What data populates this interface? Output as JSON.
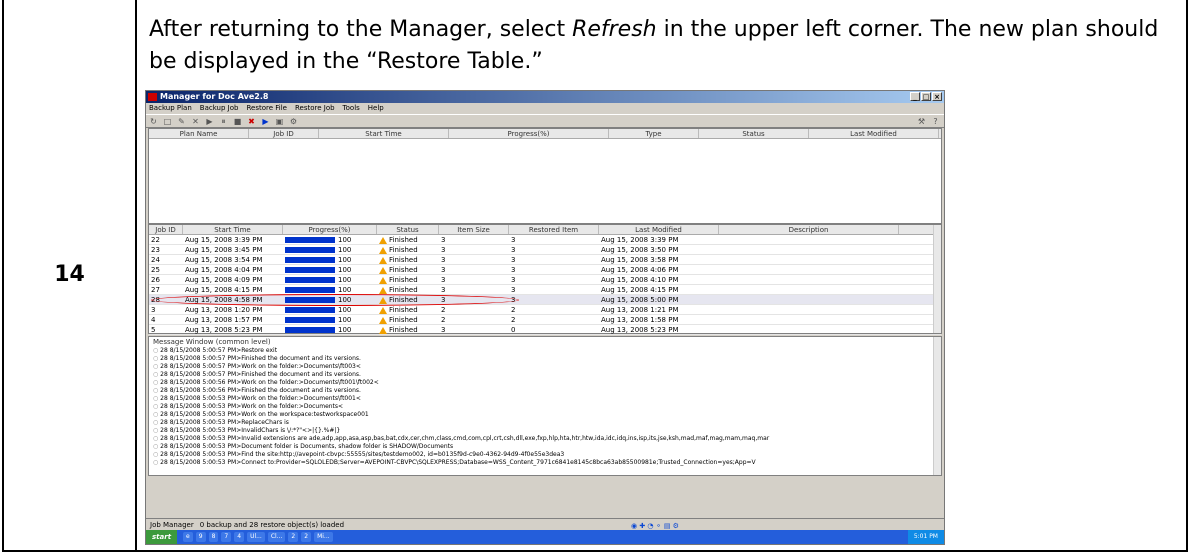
{
  "step_number": "14",
  "instruction": {
    "before": "After returning to the Manager, select ",
    "emphasis": "Refresh",
    "after": " in the upper left corner. The new plan should be displayed in the “Restore Table.”"
  },
  "app": {
    "title": "Manager for Doc Ave2.8",
    "menu": [
      "Backup Plan",
      "Backup Job",
      "Restore File",
      "Restore Job",
      "Tools",
      "Help"
    ],
    "plan_columns": [
      "Plan Name",
      "Job ID",
      "Start Time",
      "Progress(%)",
      "Type",
      "Status",
      "Last Modified"
    ],
    "job_columns": [
      "Job ID",
      "Start Time",
      "Progress(%)",
      "Status",
      "Item Size",
      "Restored Item",
      "Last Modified",
      "Description"
    ],
    "jobs": [
      {
        "id": "22",
        "start": "Aug 15, 2008 3:39 PM",
        "progress": "100",
        "status": "Finished",
        "size": "3",
        "restored": "3",
        "modified": "Aug 15, 2008 3:39 PM"
      },
      {
        "id": "23",
        "start": "Aug 15, 2008 3:45 PM",
        "progress": "100",
        "status": "Finished",
        "size": "3",
        "restored": "3",
        "modified": "Aug 15, 2008 3:50 PM"
      },
      {
        "id": "24",
        "start": "Aug 15, 2008 3:54 PM",
        "progress": "100",
        "status": "Finished",
        "size": "3",
        "restored": "3",
        "modified": "Aug 15, 2008 3:58 PM"
      },
      {
        "id": "25",
        "start": "Aug 15, 2008 4:04 PM",
        "progress": "100",
        "status": "Finished",
        "size": "3",
        "restored": "3",
        "modified": "Aug 15, 2008 4:06 PM"
      },
      {
        "id": "26",
        "start": "Aug 15, 2008 4:09 PM",
        "progress": "100",
        "status": "Finished",
        "size": "3",
        "restored": "3",
        "modified": "Aug 15, 2008 4:10 PM"
      },
      {
        "id": "27",
        "start": "Aug 15, 2008 4:15 PM",
        "progress": "100",
        "status": "Finished",
        "size": "3",
        "restored": "3",
        "modified": "Aug 15, 2008 4:15 PM"
      },
      {
        "id": "28",
        "start": "Aug 15, 2008 4:58 PM",
        "progress": "100",
        "status": "Finished",
        "size": "3",
        "restored": "3",
        "modified": "Aug 15, 2008 5:00 PM"
      },
      {
        "id": "3",
        "start": "Aug 13, 2008 1:20 PM",
        "progress": "100",
        "status": "Finished",
        "size": "2",
        "restored": "2",
        "modified": "Aug 13, 2008 1:21 PM"
      },
      {
        "id": "4",
        "start": "Aug 13, 2008 1:57 PM",
        "progress": "100",
        "status": "Finished",
        "size": "2",
        "restored": "2",
        "modified": "Aug 13, 2008 1:58 PM"
      },
      {
        "id": "5",
        "start": "Aug 13, 2008 5:23 PM",
        "progress": "100",
        "status": "Finished",
        "size": "3",
        "restored": "0",
        "modified": "Aug 13, 2008 5:23 PM"
      }
    ],
    "message_title": "Message Window  (common level)",
    "messages": [
      "28 8/15/2008 5:00:57 PM>Restore exit",
      "28 8/15/2008 5:00:57 PM>Finished the document and its versions.",
      "28 8/15/2008 5:00:57 PM>Work on the folder:>Documents\\ft003<",
      "28 8/15/2008 5:00:57 PM>Finished the document and its versions.",
      "28 8/15/2008 5:00:56 PM>Work on the folder:>Documents\\ft001\\ft002<",
      "28 8/15/2008 5:00:56 PM>Finished the document and its versions.",
      "28 8/15/2008 5:00:53 PM>Work on the folder:>Documents\\ft001<",
      "28 8/15/2008 5:00:53 PM>Work on the folder:>Documents<",
      "28 8/15/2008 5:00:53 PM>Work on the workspace:testworkspace001",
      "28 8/15/2008 5:00:53 PM>ReplaceChars is",
      "28 8/15/2008 5:00:53 PM>InvalidChars is \\/:*?\"<>|{}.%#|}",
      "28 8/15/2008 5:00:53 PM>Invalid extensions are ade,adp,app,asa,asp,bas,bat,cdx,cer,chm,class,cmd,com,cpl,crt,csh,dll,exe,fxp,hlp,hta,htr,htw,ida,idc,idq,ins,isp,its,jse,ksh,mad,maf,mag,mam,maq,mar",
      "28 8/15/2008 5:00:53 PM>Document folder is Documents, shadow folder is SHADOW/Documents",
      "28 8/15/2008 5:00:53 PM>Find the site:http://avepoint-cbvpc:55555/sites/testdemo002, id=b0135f9d-c9e0-4362-94d9-4f0e55e3dea3",
      "28 8/15/2008 5:00:53 PM>Connect to:Provider=SQLOLEDB;Server=AVEPOINT-CBVPC\\SQLEXPRESS;Database=WSS_Content_7971c6841e8145c8bca63ab85500981e;Trusted_Connection=yes;App=V"
    ],
    "status_label": "Job Manager",
    "status_text": "0 backup and 28 restore object(s) loaded",
    "start_label": "start",
    "clock": "5:01 PM"
  }
}
